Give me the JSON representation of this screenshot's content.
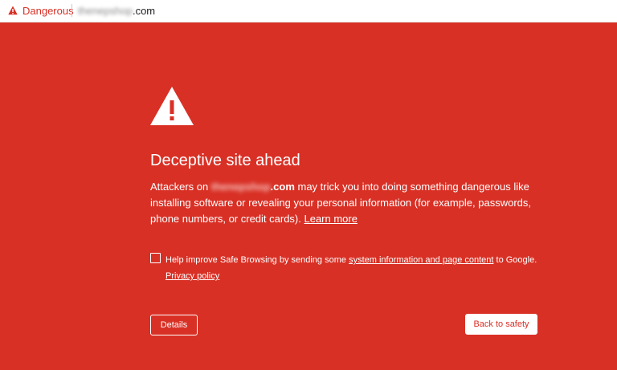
{
  "addressbar": {
    "danger_label": "Dangerous",
    "url_host": "thenepshop",
    "url_tld": ".com"
  },
  "main": {
    "heading": "Deceptive site ahead",
    "desc_prefix": "Attackers on ",
    "desc_site_host": "thenepshop",
    "desc_site_tld": ".com",
    "desc_suffix": " may trick you into doing something dangerous like installing software or revealing your personal information (for example, passwords, phone numbers, or credit cards). ",
    "learn_more": "Learn more"
  },
  "safe_browsing": {
    "text_prefix": "Help improve Safe Browsing by sending some ",
    "link_system_info": "system information and page content",
    "text_suffix": " to Google.",
    "privacy_policy": "Privacy policy",
    "checked": false
  },
  "buttons": {
    "details": "Details",
    "back_to_safety": "Back to safety"
  },
  "icons": {
    "addressbar_icon": "warning-triangle-icon",
    "main_icon": "warning-triangle-icon"
  },
  "colors": {
    "danger_red": "#d93025",
    "white": "#ffffff"
  }
}
